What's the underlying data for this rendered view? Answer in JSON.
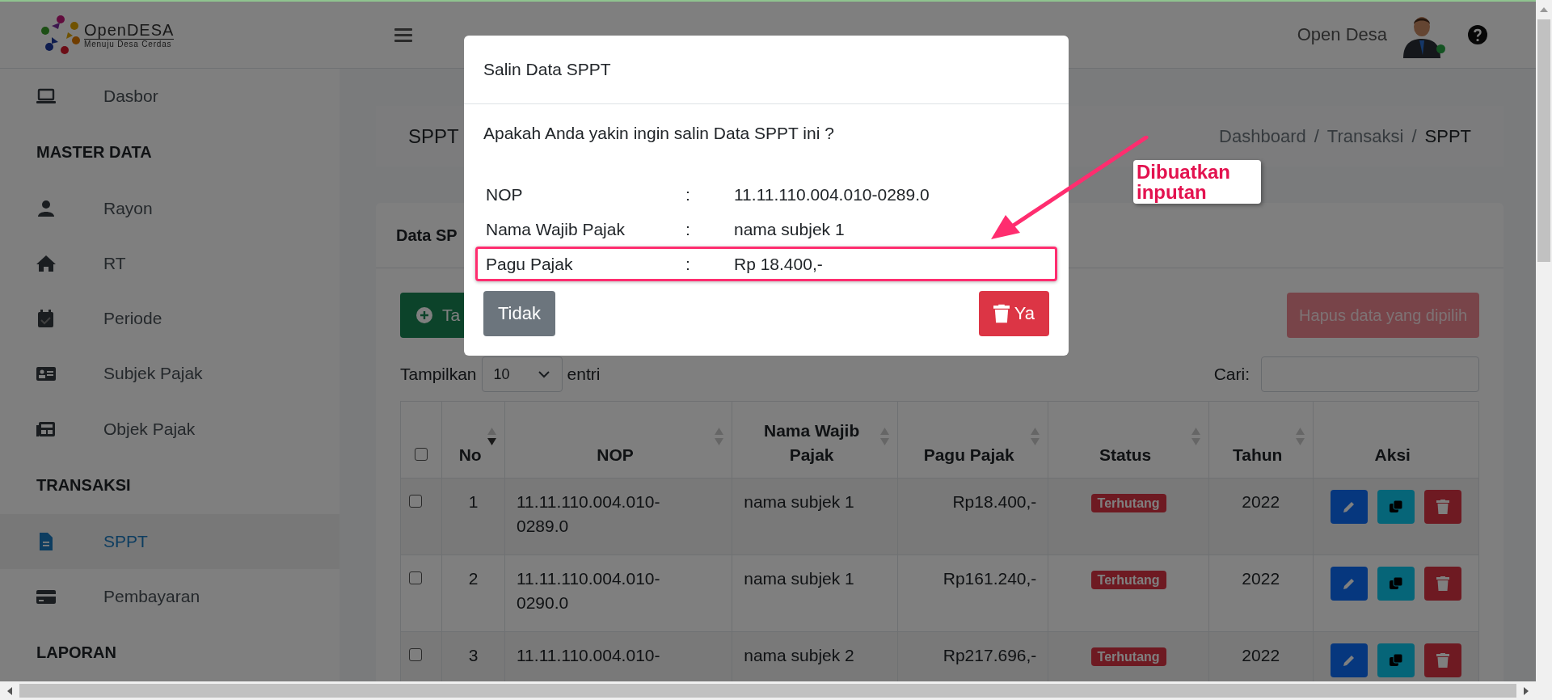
{
  "header": {
    "logo_name": "OpenDESA",
    "logo_tagline": "Menuju Desa Cerdas",
    "user_name": "Open Desa",
    "user_online": true
  },
  "sidebar": {
    "items": [
      {
        "kind": "link",
        "label": "Dasbor",
        "selected": false
      },
      {
        "kind": "heading",
        "label": "MASTER DATA"
      },
      {
        "kind": "link",
        "label": "Rayon",
        "selected": false
      },
      {
        "kind": "link",
        "label": "RT",
        "selected": false
      },
      {
        "kind": "link",
        "label": "Periode",
        "selected": false
      },
      {
        "kind": "link",
        "label": "Subjek Pajak",
        "selected": false
      },
      {
        "kind": "link",
        "label": "Objek Pajak",
        "selected": false
      },
      {
        "kind": "heading",
        "label": "TRANSAKSI"
      },
      {
        "kind": "link",
        "label": "SPPT",
        "selected": true
      },
      {
        "kind": "link",
        "label": "Pembayaran",
        "selected": false
      },
      {
        "kind": "heading",
        "label": "LAPORAN"
      }
    ]
  },
  "page": {
    "title": "SPPT",
    "breadcrumb": [
      {
        "label": "Dashboard",
        "active": false
      },
      {
        "separator_before": "/",
        "label": "Transaksi",
        "active": false
      },
      {
        "separator_before": "/",
        "label": "SPPT",
        "active": true
      }
    ]
  },
  "card": {
    "title": "Data SP",
    "add_button": "Ta",
    "delete_selected_button": "Hapus data yang dipilih",
    "delete_selected_disabled": true,
    "length_label": "Tampilkan",
    "length_value": "10",
    "length_suffix": "entri",
    "search_label": "Cari:"
  },
  "table": {
    "all_checked": false,
    "columns": [
      {
        "kind": "check"
      },
      {
        "kind": "sorted",
        "label": "No"
      },
      {
        "kind": "sortable",
        "label": "NOP"
      },
      {
        "kind": "sortable",
        "label": "Nama Wajib Pajak"
      },
      {
        "kind": "sortable",
        "label": "Pagu Pajak"
      },
      {
        "kind": "sortable",
        "label": "Status"
      },
      {
        "kind": "sortable",
        "label": "Tahun"
      },
      {
        "kind": "plain",
        "label": "Aksi"
      }
    ],
    "rows": [
      {
        "checked": false,
        "no": "1",
        "nop": "11.11.110.004.010-0289.0",
        "name": "nama subjek 1",
        "amount": "Rp18.400,-",
        "status": "Terhutang",
        "year": "2022"
      },
      {
        "checked": false,
        "no": "2",
        "nop": "11.11.110.004.010-0290.0",
        "name": "nama subjek 1",
        "amount": "Rp161.240,-",
        "status": "Terhutang",
        "year": "2022"
      },
      {
        "checked": false,
        "no": "3",
        "nop": "11.11.110.004.010-",
        "name": "nama subjek 2",
        "amount": "Rp217.696,-",
        "status": "Terhutang",
        "year": "2022"
      }
    ]
  },
  "modal": {
    "title": "Salin Data SPPT",
    "question": "Apakah Anda yakin ingin salin Data SPPT ini ?",
    "fields": [
      {
        "label": "NOP",
        "separator": ":",
        "value": "11.11.110.004.010-0289.0",
        "annotated": false
      },
      {
        "label": "Nama Wajib Pajak",
        "separator": ":",
        "value": "nama subjek 1",
        "annotated": false
      },
      {
        "label": "Pagu Pajak",
        "separator": ":",
        "value": "Rp 18.400,-",
        "annotated": true
      }
    ],
    "cancel_button": "Tidak",
    "confirm_button": "Ya"
  },
  "annotation": {
    "text": "Dibuatkan inputan"
  }
}
